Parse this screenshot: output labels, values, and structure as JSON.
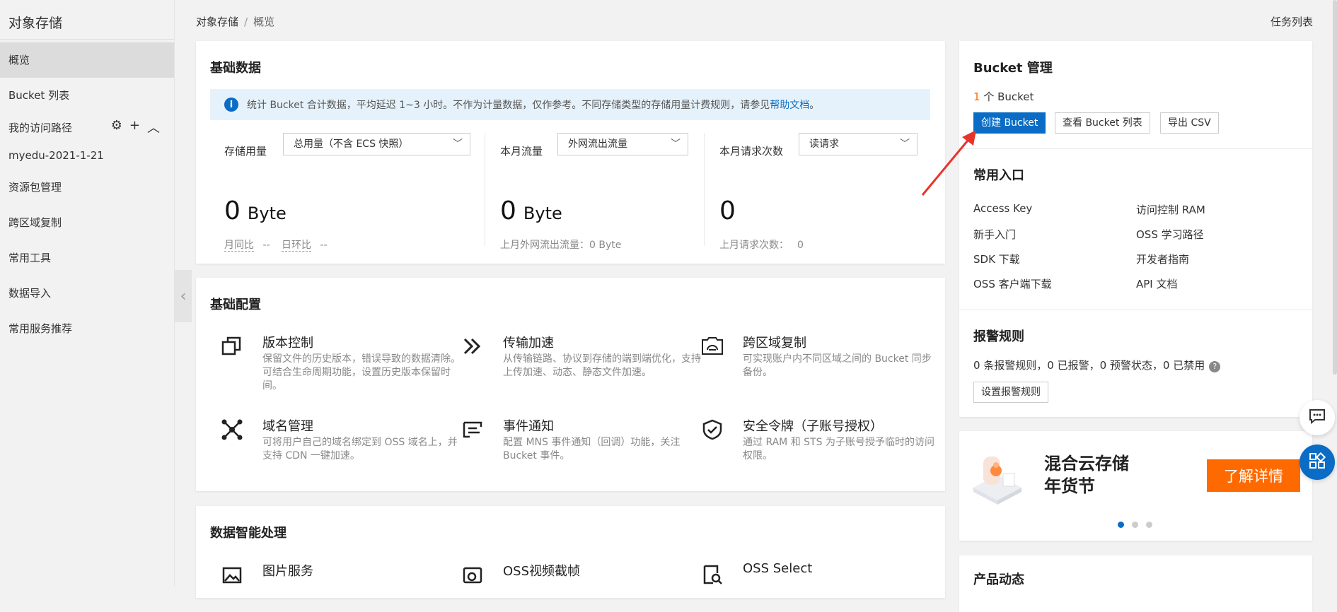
{
  "sidebar": {
    "title": "对象存储",
    "items": [
      {
        "label": "概览",
        "active": true
      },
      {
        "label": "Bucket 列表"
      }
    ],
    "access_paths": {
      "label": "我的访问路径",
      "entry": "myedu-2021-1-21"
    },
    "more_items": [
      {
        "label": "资源包管理"
      },
      {
        "label": "跨区域复制"
      },
      {
        "label": "常用工具"
      },
      {
        "label": "数据导入"
      },
      {
        "label": "常用服务推荐"
      }
    ]
  },
  "breadcrumb": {
    "root": "对象存储",
    "sep": "/",
    "current": "概览"
  },
  "task_list": "任务列表",
  "basic_data": {
    "title": "基础数据",
    "notice_text": "统计 Bucket 合计数据，平均延迟 1~3 小时。不作为计量数据，仅作参考。不同存储类型的存储用量计费规则，请参见",
    "notice_link": "帮助文档",
    "notice_end": "。",
    "storage": {
      "label": "存储用量",
      "select": "总用量（不含 ECS 快照）",
      "value": "0",
      "unit": "Byte",
      "yoy_label": "月同比",
      "yoy_value": "--",
      "dod_label": "日环比",
      "dod_value": "--"
    },
    "traffic": {
      "label": "本月流量",
      "select": "外网流出流量",
      "value": "0",
      "unit": "Byte",
      "sub": "上月外网流出流量：0 Byte"
    },
    "requests": {
      "label": "本月请求次数",
      "select": "读请求",
      "value": "0",
      "sub_label": "上月请求次数：",
      "sub_value": "0"
    }
  },
  "basic_config": {
    "title": "基础配置",
    "features": [
      {
        "title": "版本控制",
        "desc": "保留文件的历史版本，错误导致的数据清除。可结合生命周期功能，设置历史版本保留时间。",
        "icon": "copy-icon"
      },
      {
        "title": "传输加速",
        "desc": "从传输链路、协议到存储的端到端优化，支持上传加速、动态、静态文件加速。",
        "icon": "double-chevron-icon"
      },
      {
        "title": "跨区域复制",
        "desc": "可实现账户内不同区域之间的 Bucket 同步备份。",
        "icon": "cloud-sync-icon"
      },
      {
        "title": "域名管理",
        "desc": "可将用户自己的域名绑定到 OSS 域名上，并支持 CDN 一键加速。",
        "icon": "network-icon"
      },
      {
        "title": "事件通知",
        "desc": "配置 MNS 事件通知（回调）功能，关注 Bucket 事件。",
        "icon": "notification-icon"
      },
      {
        "title": "安全令牌（子账号授权）",
        "desc": "通过 RAM 和 STS 为子账号授予临时的访问权限。",
        "icon": "shield-check-icon"
      }
    ]
  },
  "data_processing": {
    "title": "数据智能处理",
    "items": [
      {
        "title": "图片服务",
        "icon": "image-icon"
      },
      {
        "title": "OSS视频截帧",
        "icon": "video-icon"
      },
      {
        "title": "OSS Select",
        "icon": "search-doc-icon"
      }
    ]
  },
  "bucket_mgmt": {
    "title": "Bucket 管理",
    "count": "1",
    "count_unit": "个 Bucket",
    "create": "创建 Bucket",
    "view_list": "查看 Bucket 列表",
    "export": "导出 CSV"
  },
  "common_entry": {
    "title": "常用入口",
    "links": [
      "Access Key",
      "访问控制 RAM",
      "新手入门",
      "OSS 学习路径",
      "SDK 下载",
      "开发者指南",
      "OSS 客户端下载",
      "API 文档"
    ]
  },
  "alarm": {
    "title": "报警规则",
    "summary": "0 条报警规则，0 已报警，0 预警状态，0 已禁用",
    "help": "?",
    "button": "设置报警规则"
  },
  "promo": {
    "line1": "混合云存储",
    "line2": "年货节",
    "cta": "了解详情"
  },
  "product_news": {
    "title": "产品动态"
  },
  "colors": {
    "primary": "#0a6cc4",
    "orange": "#ff6a00",
    "annotation": "#e8332a"
  }
}
